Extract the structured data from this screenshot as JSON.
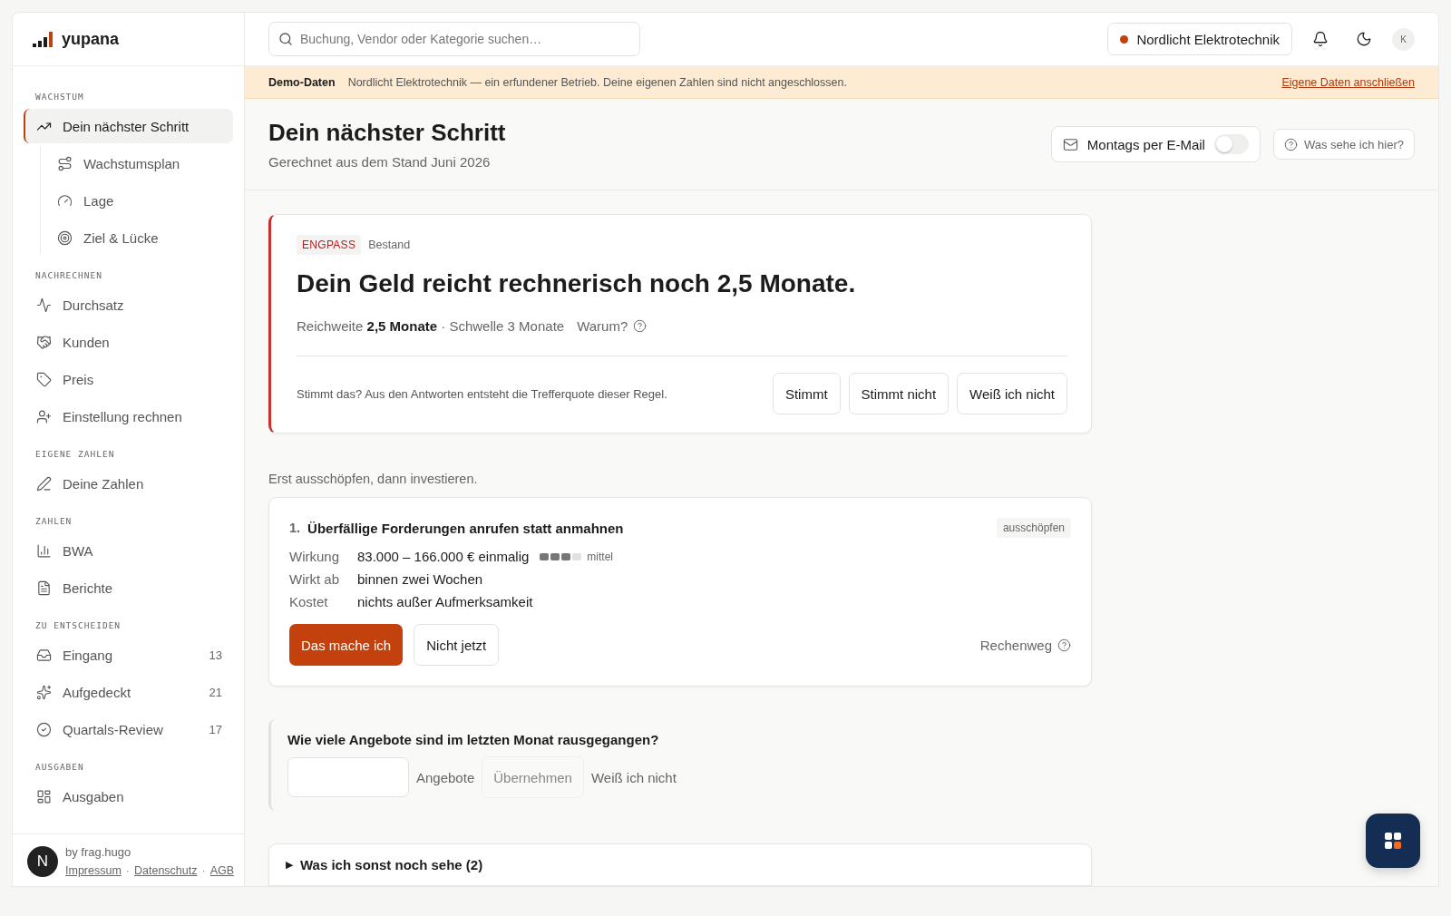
{
  "brand": {
    "name": "yupana"
  },
  "sidebar": {
    "sections": [
      {
        "title": "WACHSTUM",
        "items": [
          {
            "label": "Dein nächster Schritt",
            "selected": true,
            "children": [
              {
                "label": "Wachstumsplan",
                "selected": false
              },
              {
                "label": "Lage",
                "selected": false
              },
              {
                "label": "Ziel & Lücke",
                "selected": false
              }
            ]
          }
        ]
      },
      {
        "title": "NACHRECHNEN",
        "items": [
          {
            "label": "Durchsatz",
            "selected": false
          },
          {
            "label": "Kunden",
            "selected": false
          },
          {
            "label": "Preis",
            "selected": false
          },
          {
            "label": "Einstellung rechnen",
            "selected": false
          }
        ]
      },
      {
        "title": "EIGENE ZAHLEN",
        "items": [
          {
            "label": "Deine Zahlen",
            "selected": false
          }
        ]
      },
      {
        "title": "ZAHLEN",
        "items": [
          {
            "label": "BWA",
            "selected": false
          },
          {
            "label": "Berichte",
            "selected": false
          }
        ]
      },
      {
        "title": "ZU ENTSCHEIDEN",
        "items": [
          {
            "label": "Eingang",
            "selected": false,
            "count": "13"
          },
          {
            "label": "Aufgedeckt",
            "selected": false,
            "count": "21"
          },
          {
            "label": "Quartals-Review",
            "selected": false,
            "count": "17"
          }
        ]
      },
      {
        "title": "AUSGABEN",
        "items": [
          {
            "label": "Ausgaben",
            "selected": false
          }
        ]
      }
    ],
    "footer": {
      "badge": "N",
      "credit": "by frag.hugo",
      "links": [
        "Impressum",
        "Datenschutz",
        "AGB"
      ],
      "separators": [
        "·",
        "·"
      ]
    }
  },
  "topbar": {
    "search": {
      "placeholder": "Buchung, Vendor oder Kategorie suchen…"
    },
    "company": {
      "name": "Nordlicht Elektrotechnik",
      "color": "#c2410c"
    },
    "avatar": "K"
  },
  "banner": {
    "label": "Demo-Daten",
    "text": "Nordlicht Elektrotechnik — ein erfundener Betrieb. Deine eigenen Zahlen sind nicht angeschlossen.",
    "link": "Eigene Daten anschließen"
  },
  "page": {
    "title": "Dein nächster Schritt",
    "subtitle": "Gerechnet aus dem Stand Juni 2026",
    "email_toggle": {
      "label": "Montags per E-Mail",
      "on": false
    },
    "help": "Was sehe ich hier?"
  },
  "alert": {
    "tag": "ENGPASS",
    "category": "Bestand",
    "headline": "Dein Geld reicht rechnerisch noch 2,5 Monate.",
    "facts": "Reichweite **2,5 Monate** · Schwelle 3 Monate",
    "why": "Warum?",
    "question": "Stimmt das? Aus den Antworten entsteht die Trefferquote dieser Regel.",
    "buttons": [
      "Stimmt",
      "Stimmt nicht",
      "Weiß ich nicht"
    ]
  },
  "intro": "Erst ausschöpfen, dann investieren.",
  "actions": [
    {
      "number": "1.",
      "title": "Überfällige Forderungen anrufen statt anmahnen",
      "tag": "ausschöpfen",
      "rows": [
        {
          "label": "Wirkung",
          "value": "83.000 – 166.000 € einmalig",
          "level": 0.75,
          "level_label": "mittel"
        },
        {
          "label": "Wirkt ab",
          "value": "binnen zwei Wochen"
        },
        {
          "label": "Kostet",
          "value": "nichts außer Aufmerksamkeit"
        }
      ],
      "primary": "Das mache ich",
      "secondary": "Nicht jetzt",
      "link": "Rechenweg"
    }
  ],
  "prompt": {
    "question": "Wie viele Angebote sind im letzten Monat rausgegangen?",
    "unit": "Angebote",
    "submit": "Übernehmen",
    "skip": "Weiß ich nicht"
  },
  "more": {
    "label": "Was ich sonst noch sehe (2)",
    "expanded": false,
    "marker": "▶"
  }
}
